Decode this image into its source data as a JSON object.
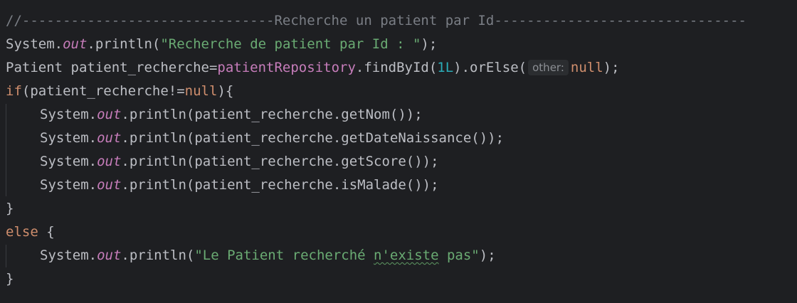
{
  "code": {
    "line1": {
      "comment": "//-------------------------------Recherche un patient par Id-------------------------------"
    },
    "line2": {
      "system": "System.",
      "out": "out",
      "println_open": ".println(",
      "string": "\"Recherche de patient par Id : \"",
      "close": ");"
    },
    "line3": {
      "decl": "Patient patient_recherche=",
      "repo": "patientRepository",
      "find_open": ".findById(",
      "id": "1L",
      "or_else_open": ").orElse(",
      "hint_label": "other:",
      "null_kw": "null",
      "close": ");"
    },
    "line4": {
      "if_kw": "if",
      "cond_open": "(patient_recherche!=",
      "null_kw": "null",
      "close": "){"
    },
    "line5": {
      "system": "System.",
      "out": "out",
      "call": ".println(patient_recherche.getNom());"
    },
    "line6": {
      "system": "System.",
      "out": "out",
      "call": ".println(patient_recherche.getDateNaissance());"
    },
    "line7": {
      "system": "System.",
      "out": "out",
      "call": ".println(patient_recherche.getScore());"
    },
    "line8": {
      "system": "System.",
      "out": "out",
      "call": ".println(patient_recherche.isMalade());"
    },
    "line9": {
      "brace": "}"
    },
    "line10": {
      "else_kw": "else",
      "brace": " {"
    },
    "line11": {
      "system": "System.",
      "out": "out",
      "println_open": ".println(",
      "string_a": "\"Le Patient recherché ",
      "string_typo": "n'existe",
      "string_b": " pas\"",
      "close": ");"
    },
    "line12": {
      "brace": "}"
    }
  },
  "colors": {
    "background": "#1e1f22",
    "text": "#bcbec4",
    "comment": "#7a7e85",
    "keyword": "#cf8e6d",
    "string": "#6aab73",
    "number": "#2aacb8",
    "static_field": "#c77dbb",
    "inlay_hint_bg": "#2b2d30",
    "inlay_hint_text": "#8c8f94"
  }
}
